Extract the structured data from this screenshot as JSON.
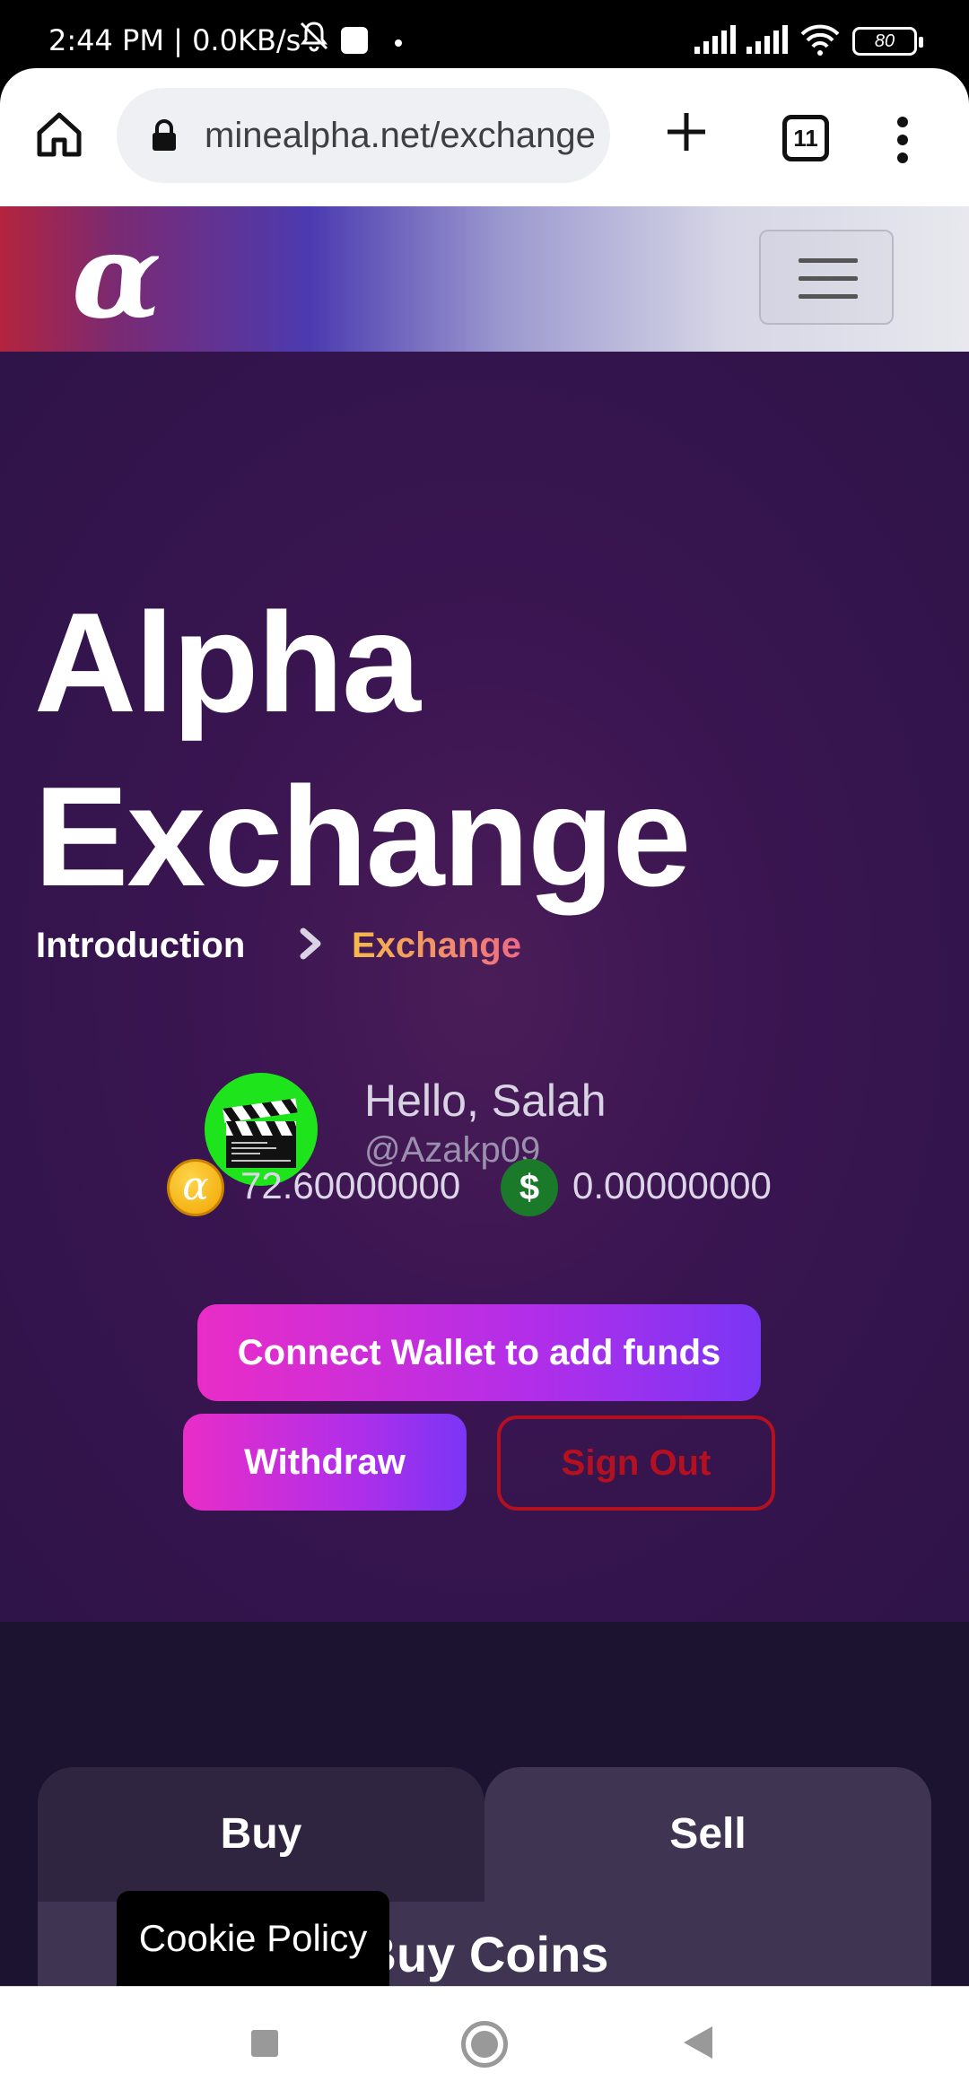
{
  "status_bar": {
    "time": "2:44 PM | 0.0KB/s",
    "battery": "80"
  },
  "browser": {
    "url": "minealpha.net/exchange",
    "tab_count": "11"
  },
  "site": {
    "logo": "α"
  },
  "hero": {
    "title_line1": "Alpha",
    "title_line2": "Exchange",
    "breadcrumb": {
      "parent": "Introduction",
      "current": "Exchange"
    },
    "greeting": "Hello, Salah",
    "handle": "@Azakp09",
    "alpha_symbol": "α",
    "alpha_balance": "72.60000000",
    "usd_symbol": "$",
    "usd_balance": "0.00000000",
    "connect_label": "Connect Wallet to add funds",
    "withdraw_label": "Withdraw",
    "signout_label": "Sign Out"
  },
  "trade": {
    "tabs": [
      {
        "label": "Buy"
      },
      {
        "label": "Sell"
      }
    ],
    "panel_title": "Buy Coins"
  },
  "cookie": {
    "label": "Cookie Policy"
  },
  "colors": {
    "hero_bg": "#3a1551",
    "accent_gradient_start": "#e92dc7",
    "accent_gradient_end": "#7a36f5",
    "signout": "#b51020",
    "breadcrumb_current_start": "#f6b94a",
    "breadcrumb_current_end": "#ee6a86"
  }
}
